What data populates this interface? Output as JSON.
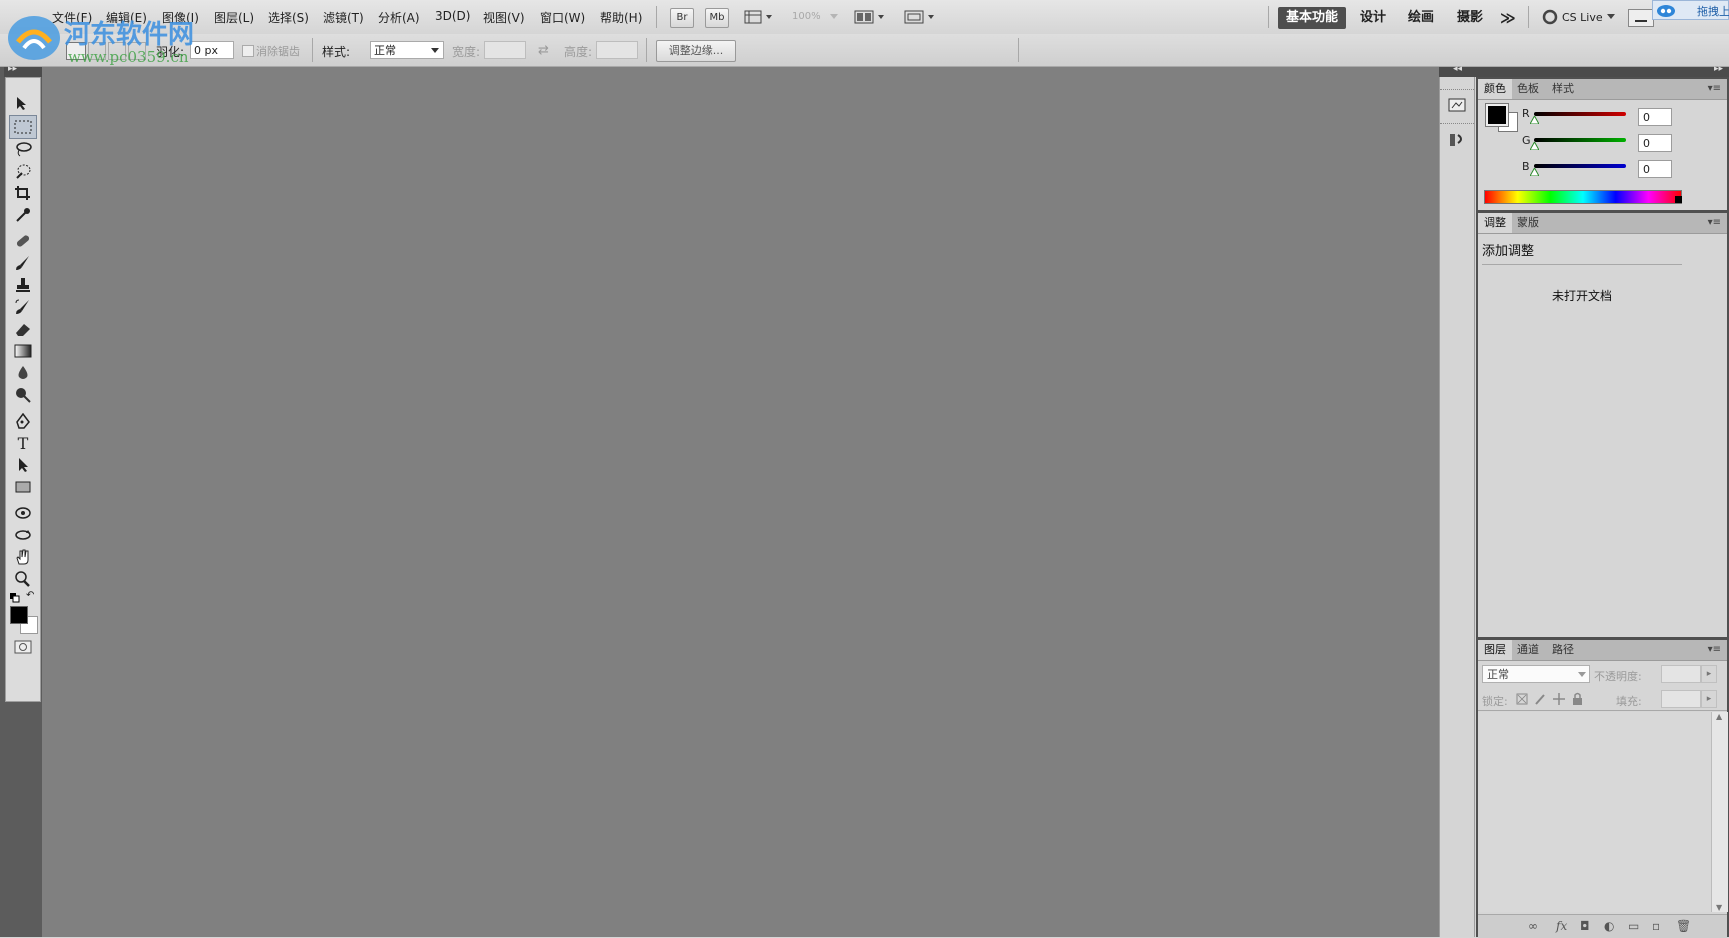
{
  "watermark": {
    "title": "河东软件网",
    "url": "www.pc0359.cn"
  },
  "menubar": {
    "items": [
      "文件(F)",
      "编辑(E)",
      "图像(I)",
      "图层(L)",
      "选择(S)",
      "滤镜(T)",
      "分析(A)",
      "3D(D)",
      "视图(V)",
      "窗口(W)",
      "帮助(H)"
    ],
    "bridge_label": "Br",
    "minibridge_label": "Mb",
    "zoom": "100%",
    "workspaces": [
      "基本功能",
      "设计",
      "绘画",
      "摄影"
    ],
    "more_label": "≫",
    "cslive_label": "CS Live",
    "upload_hint": "拖拽上"
  },
  "options": {
    "feather_label": "羽化:",
    "feather_value": "0 px",
    "antialias_label": "消除锯齿",
    "style_label": "样式:",
    "style_value": "正常",
    "width_label": "宽度:",
    "height_label": "高度:",
    "refine_label": "调整边缘..."
  },
  "color_panel": {
    "tabs": [
      "颜色",
      "色板",
      "样式"
    ],
    "channels": [
      {
        "name": "R",
        "value": "0",
        "color": "#cc0000"
      },
      {
        "name": "G",
        "value": "0",
        "color": "#00aa00"
      },
      {
        "name": "B",
        "value": "0",
        "color": "#0000cc"
      }
    ]
  },
  "adjust_panel": {
    "tabs": [
      "调整",
      "蒙版"
    ],
    "title": "添加调整",
    "empty_message": "未打开文档"
  },
  "layers_panel": {
    "tabs": [
      "图层",
      "通道",
      "路径"
    ],
    "blend_mode": "正常",
    "opacity_label": "不透明度:",
    "lock_label": "锁定:",
    "fill_label": "填充:"
  },
  "colors": {
    "canvas": "#808080",
    "accent": "#4e4e4e"
  }
}
